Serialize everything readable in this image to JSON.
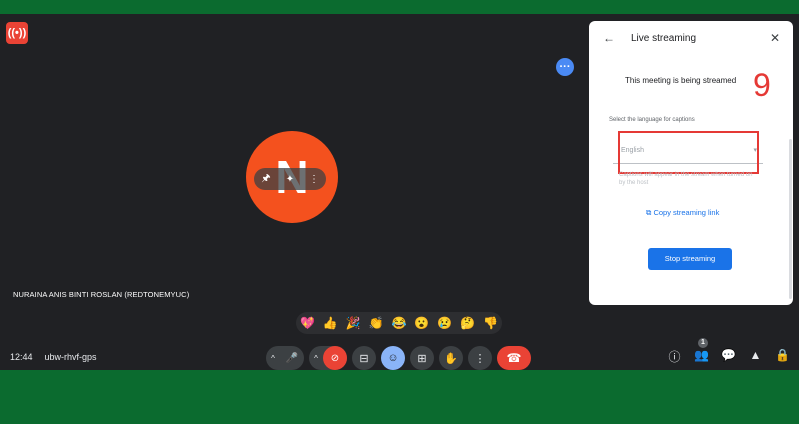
{
  "colors": {
    "frame": "#0b6b2f",
    "meet_bg": "#202124",
    "avatar": "#f4511e",
    "accent_red": "#ea4335",
    "accent_blue": "#1a73e8",
    "annotation": "#e53935"
  },
  "top_left": {
    "icon": "live-broadcast-icon",
    "glyph": "((•))"
  },
  "more_glyph": "···",
  "participant": {
    "initial": "N",
    "name": "NURAINA ANIS BINTI ROSLAN (REDTONEMYUC)",
    "tile_controls": [
      "🖈",
      "✦",
      "⋮"
    ]
  },
  "reactions": [
    "💖",
    "👍",
    "🎉",
    "👏",
    "😂",
    "😮",
    "😢",
    "🤔",
    "👎"
  ],
  "meeting": {
    "time": "12:44",
    "code": "ubw-rhvf-gps"
  },
  "controls": {
    "mic": {
      "chev": "^",
      "icon": "🎤"
    },
    "camera": {
      "chev": "^",
      "icon": "⊘"
    },
    "captions": "⊟",
    "emoji": "☺",
    "present": "⊞",
    "raise_hand": "✋",
    "more": "⋮",
    "end_call": "☎"
  },
  "right_controls": {
    "info": "ⓘ",
    "people": "👥",
    "people_badge": "1",
    "chat": "💬",
    "activities": "▲",
    "host": "🔒"
  },
  "panel": {
    "back": "←",
    "title": "Live streaming",
    "close": "✕",
    "status": "This meeting is being streamed",
    "annotation_number": "9",
    "language_label": "Select the language for captions",
    "language_value": "English",
    "language_caret": "▾",
    "helper_text": "Captions will appear in the stream when turned on by the host",
    "copy_link": "Copy streaming link",
    "stop_button": "Stop streaming"
  }
}
